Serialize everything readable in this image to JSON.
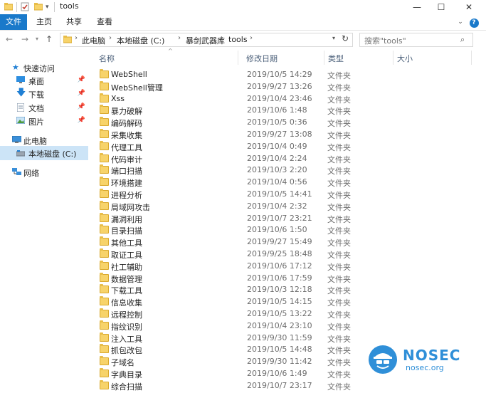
{
  "window": {
    "title": "tools",
    "minimize": "—",
    "maximize": "☐",
    "close": "✕"
  },
  "ribbon": {
    "tabs": [
      "文件",
      "主页",
      "共享",
      "查看"
    ],
    "help": "?"
  },
  "address": {
    "crumbs": [
      "此电脑",
      "本地磁盘 (C:)",
      "暴剑武器库",
      "tools"
    ],
    "search_placeholder": "搜索\"tools\""
  },
  "sidebar": {
    "items": [
      {
        "label": "快速访问",
        "icon": "star-icon"
      },
      {
        "label": "桌面",
        "icon": "desktop-icon",
        "pinned": true
      },
      {
        "label": "下载",
        "icon": "download-icon",
        "pinned": true
      },
      {
        "label": "文档",
        "icon": "document-icon",
        "pinned": true
      },
      {
        "label": "图片",
        "icon": "picture-icon",
        "pinned": true
      },
      {
        "label": "此电脑",
        "icon": "computer-icon"
      },
      {
        "label": "本地磁盘 (C:)",
        "icon": "drive-icon",
        "selected": true
      },
      {
        "label": "网络",
        "icon": "network-icon"
      }
    ]
  },
  "columns": {
    "name": "名称",
    "modified": "修改日期",
    "type": "类型",
    "size": "大小"
  },
  "files": [
    {
      "name": "WebShell",
      "date": "2019/10/5 14:29",
      "type": "文件夹"
    },
    {
      "name": "WebShell管理",
      "date": "2019/9/27 13:26",
      "type": "文件夹"
    },
    {
      "name": "Xss",
      "date": "2019/10/4 23:46",
      "type": "文件夹"
    },
    {
      "name": "暴力破解",
      "date": "2019/10/6 1:48",
      "type": "文件夹"
    },
    {
      "name": "编码解码",
      "date": "2019/10/5 0:36",
      "type": "文件夹"
    },
    {
      "name": "采集收集",
      "date": "2019/9/27 13:08",
      "type": "文件夹"
    },
    {
      "name": "代理工具",
      "date": "2019/10/4 0:49",
      "type": "文件夹"
    },
    {
      "name": "代码审计",
      "date": "2019/10/4 2:24",
      "type": "文件夹"
    },
    {
      "name": "端口扫描",
      "date": "2019/10/3 2:20",
      "type": "文件夹"
    },
    {
      "name": "环境搭建",
      "date": "2019/10/4 0:56",
      "type": "文件夹"
    },
    {
      "name": "进程分析",
      "date": "2019/10/5 14:41",
      "type": "文件夹"
    },
    {
      "name": "局域网攻击",
      "date": "2019/10/4 2:32",
      "type": "文件夹"
    },
    {
      "name": "漏洞利用",
      "date": "2019/10/7 23:21",
      "type": "文件夹"
    },
    {
      "name": "目录扫描",
      "date": "2019/10/6 1:50",
      "type": "文件夹"
    },
    {
      "name": "其他工具",
      "date": "2019/9/27 15:49",
      "type": "文件夹"
    },
    {
      "name": "取证工具",
      "date": "2019/9/25 18:48",
      "type": "文件夹"
    },
    {
      "name": "社工辅助",
      "date": "2019/10/6 17:12",
      "type": "文件夹"
    },
    {
      "name": "数据管理",
      "date": "2019/10/6 17:59",
      "type": "文件夹"
    },
    {
      "name": "下载工具",
      "date": "2019/10/3 12:18",
      "type": "文件夹"
    },
    {
      "name": "信息收集",
      "date": "2019/10/5 14:15",
      "type": "文件夹"
    },
    {
      "name": "远程控制",
      "date": "2019/10/5 13:22",
      "type": "文件夹"
    },
    {
      "name": "指纹识别",
      "date": "2019/10/4 23:10",
      "type": "文件夹"
    },
    {
      "name": "注入工具",
      "date": "2019/9/30 11:59",
      "type": "文件夹"
    },
    {
      "name": "抓包改包",
      "date": "2019/10/5 14:48",
      "type": "文件夹"
    },
    {
      "name": "子域名",
      "date": "2019/9/30 11:42",
      "type": "文件夹"
    },
    {
      "name": "字典目录",
      "date": "2019/10/6 1:49",
      "type": "文件夹"
    },
    {
      "name": "综合扫描",
      "date": "2019/10/7 23:17",
      "type": "文件夹"
    }
  ],
  "watermark": {
    "brand": "NOSEC",
    "site": "nosec.org"
  },
  "colors": {
    "accent": "#1979ca",
    "selected": "#cce4f7",
    "folder": "#f7d36a",
    "watermark": "#2f8fd8"
  }
}
